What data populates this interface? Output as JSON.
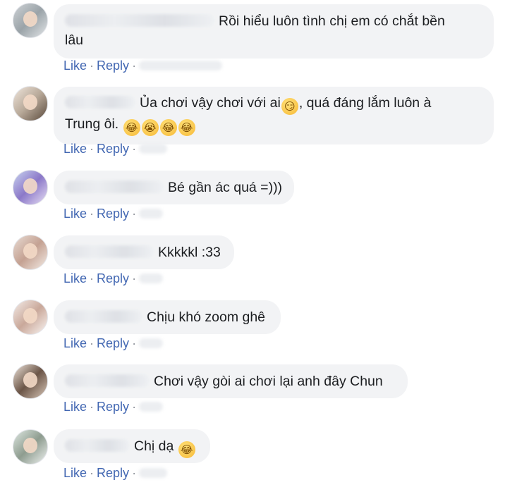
{
  "like_label": "Like",
  "reply_label": "Reply",
  "separator": "·",
  "colors": {
    "link": "#4267b2",
    "bubble": "#f2f3f5",
    "text": "#1c1e21"
  },
  "comments": [
    {
      "line1": "Rồi hiểu luôn tình chị em có chắt bền",
      "line2": "lâu"
    },
    {
      "text_a": "Ủa chơi vậy chơi với ai",
      "text_b": ", quá đáng lắm luôn à",
      "line2": "Trung ôi.",
      "emoji_wink": "😏",
      "emoji_laugh": "😂",
      "emoji_cry": "😭"
    },
    {
      "text": "Bé gần ác quá =)))"
    },
    {
      "text": "Kkkkkl :33"
    },
    {
      "text": "Chịu khó zoom ghê"
    },
    {
      "text": "Chơi vậy gòi ai chơi lại anh đây Chun"
    },
    {
      "text": "Chị dạ",
      "emoji_laugh": "😂"
    }
  ]
}
